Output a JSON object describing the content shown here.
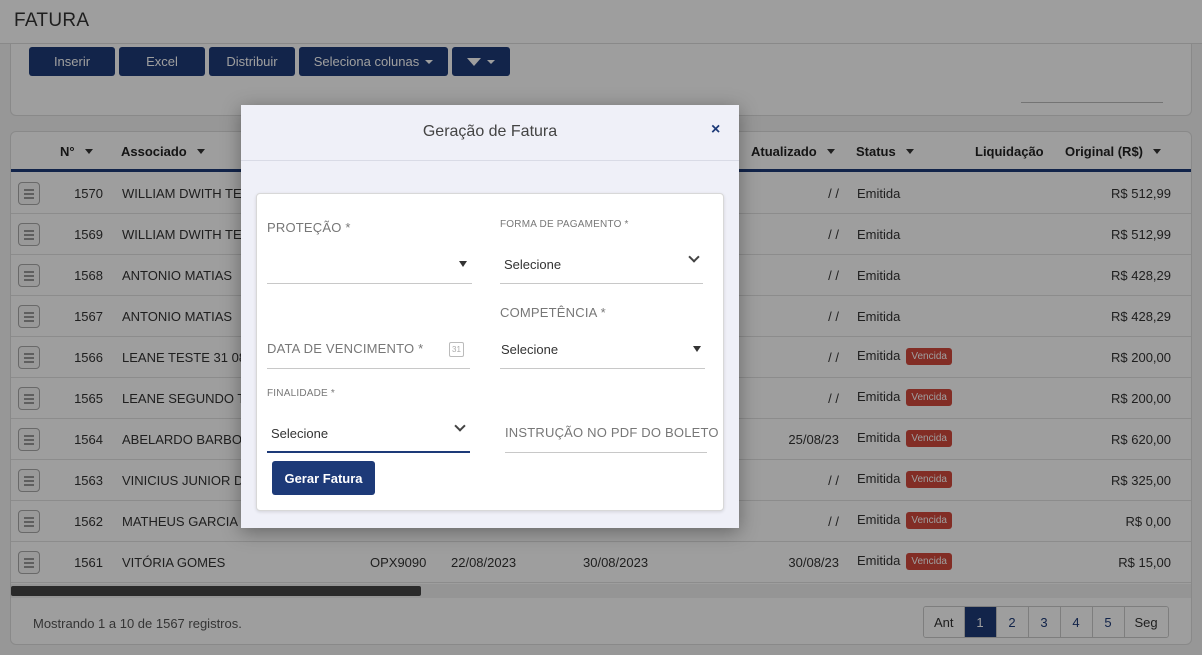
{
  "page": {
    "title": "FATURA"
  },
  "toolbar": {
    "insert_label": "Inserir",
    "excel_label": "Excel",
    "distribute_label": "Distribuir",
    "columns_label": "Seleciona colunas"
  },
  "table": {
    "headers": {
      "num": "N°",
      "associado": "Associado",
      "atualizado": "Atualizado",
      "status": "Status",
      "liquidacao": "Liquidação",
      "original": "Original (R$)"
    },
    "rows": [
      {
        "num": "1570",
        "associado": "WILLIAM DWITH TESTE",
        "placa": "",
        "data1": "",
        "data2": "",
        "atualizado": "/ /",
        "status": "Emitida",
        "badge": "",
        "valor": "R$ 512,99"
      },
      {
        "num": "1569",
        "associado": "WILLIAM DWITH TESTE",
        "placa": "",
        "data1": "",
        "data2": "",
        "atualizado": "/ /",
        "status": "Emitida",
        "badge": "",
        "valor": "R$ 512,99"
      },
      {
        "num": "1568",
        "associado": "ANTONIO MATIAS",
        "placa": "",
        "data1": "",
        "data2": "",
        "atualizado": "/ /",
        "status": "Emitida",
        "badge": "",
        "valor": "R$ 428,29"
      },
      {
        "num": "1567",
        "associado": "ANTONIO MATIAS",
        "placa": "",
        "data1": "",
        "data2": "",
        "atualizado": "/ /",
        "status": "Emitida",
        "badge": "",
        "valor": "R$ 428,29"
      },
      {
        "num": "1566",
        "associado": "LEANE TESTE 31 08",
        "placa": "",
        "data1": "",
        "data2": "",
        "atualizado": "/ /",
        "status": "Emitida",
        "badge": "Vencida",
        "valor": "R$ 200,00"
      },
      {
        "num": "1565",
        "associado": "LEANE SEGUNDO TESTE",
        "placa": "",
        "data1": "",
        "data2": "",
        "atualizado": "/ /",
        "status": "Emitida",
        "badge": "Vencida",
        "valor": "R$ 200,00"
      },
      {
        "num": "1564",
        "associado": "ABELARDO BARBOSA",
        "placa": "",
        "data1": "",
        "data2": "",
        "atualizado": "25/08/23",
        "status": "Emitida",
        "badge": "Vencida",
        "valor": "R$ 620,00"
      },
      {
        "num": "1563",
        "associado": "VINICIUS JUNIOR DW",
        "placa": "",
        "data1": "",
        "data2": "",
        "atualizado": "/ /",
        "status": "Emitida",
        "badge": "Vencida",
        "valor": "R$ 325,00"
      },
      {
        "num": "1562",
        "associado": "MATHEUS GARCIA CU",
        "placa": "",
        "data1": "",
        "data2": "",
        "atualizado": "/ /",
        "status": "Emitida",
        "badge": "Vencida",
        "valor": "R$ 0,00"
      },
      {
        "num": "1561",
        "associado": "VITÓRIA GOMES",
        "placa": "OPX9090",
        "data1": "22/08/2023",
        "data2": "30/08/2023",
        "atualizado": "30/08/23",
        "status": "Emitida",
        "badge": "Vencida",
        "valor": "R$ 15,00"
      }
    ]
  },
  "footer": {
    "info": "Mostrando 1 a 10 de 1567 registros.",
    "pager": [
      "Ant",
      "1",
      "2",
      "3",
      "4",
      "5",
      "Seg"
    ]
  },
  "modal": {
    "title": "Geração de Fatura",
    "close": "×",
    "protecao_label": "PROTEÇÃO *",
    "forma_label": "FORMA DE PAGAMENTO *",
    "forma_value": "Selecione",
    "competencia_label": "COMPETÊNCIA *",
    "competencia_value": "Selecione",
    "vencimento_label": "DATA DE VENCIMENTO *",
    "calendar_day": "31",
    "finalidade_label": "FINALIDADE *",
    "finalidade_value": "Selecione",
    "instrucao_placeholder": "INSTRUÇÃO NO PDF DO BOLETO",
    "submit_label": "Gerar Fatura"
  },
  "colors": {
    "primary": "#1d3a78",
    "badge": "#d24a3c"
  }
}
